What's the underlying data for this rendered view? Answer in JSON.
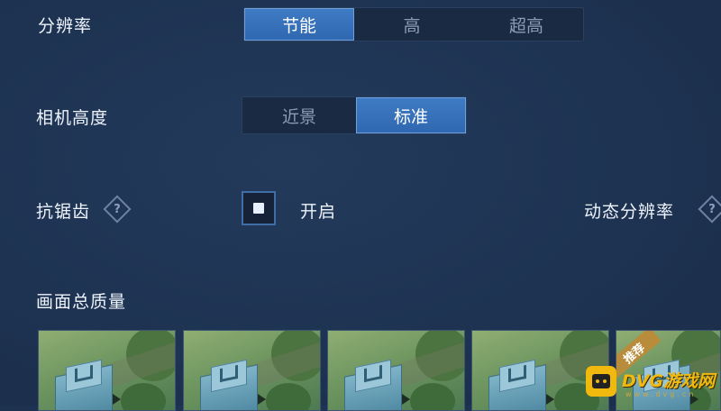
{
  "resolution": {
    "label": "分辨率",
    "options": [
      "节能",
      "高",
      "超高"
    ],
    "selected": "节能"
  },
  "camera_height": {
    "label": "相机高度",
    "options": [
      "近景",
      "标准"
    ],
    "selected": "标准"
  },
  "anti_aliasing": {
    "label": "抗锯齿",
    "help_glyph": "?",
    "toggle_label": "开启",
    "checked": true
  },
  "dynamic_resolution": {
    "label": "动态分辨率",
    "help_glyph": "?"
  },
  "overall_quality": {
    "label": "画面总质量",
    "thumbnails": [
      {
        "badge": ""
      },
      {
        "badge": ""
      },
      {
        "badge": ""
      },
      {
        "badge": ""
      },
      {
        "badge": "推荐"
      }
    ]
  },
  "watermark": {
    "brand": "DVG游戏网",
    "url": "www.dvg.cn"
  },
  "colors": {
    "background": "#1e3352",
    "active_option": "#3f7bc4",
    "watermark": "#f1b90e"
  }
}
